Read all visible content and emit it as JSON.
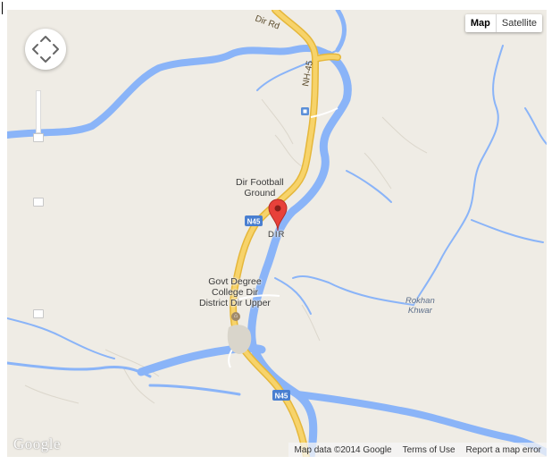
{
  "map_type_control": {
    "map_label": "Map",
    "satellite_label": "Satellite",
    "selected": "Map"
  },
  "road_labels": {
    "dir_rd": "Dir Rd",
    "nh45": "NH-45",
    "n45_a": "N45",
    "n45_b": "N45"
  },
  "places": {
    "football_ground": "Dir Football\nGround",
    "dir": "DIR",
    "college": "Govt Degree\nCollege Dir\nDistrict Dir Upper"
  },
  "water_labels": {
    "rokhan_khwar": "Rokhan\nKhwar"
  },
  "footer": {
    "map_data": "Map data ©2014 Google",
    "terms": "Terms of Use",
    "report": "Report a map error"
  },
  "logo_text": "Google",
  "colors": {
    "land": "#efece5",
    "water": "#8ab4f8",
    "road_fill": "#f7d36a",
    "road_casing": "#e5b73b",
    "marker": "#e8413a"
  },
  "icons": [
    "pan-control-icon",
    "map-marker-icon",
    "school-icon",
    "poi-icon"
  ]
}
